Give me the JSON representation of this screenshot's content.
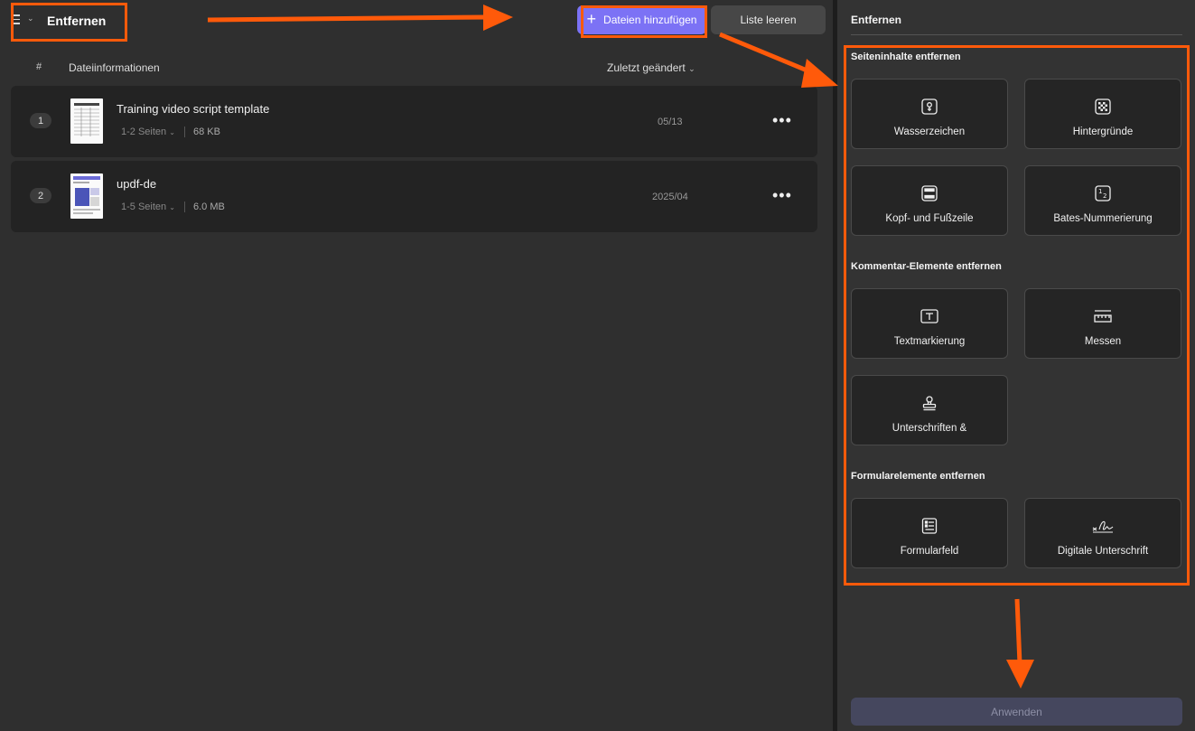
{
  "header": {
    "title": "Entfernen",
    "add_files_label": "Dateien hinzufügen",
    "clear_list_label": "Liste leeren"
  },
  "table": {
    "col_number": "#",
    "col_info": "Dateiinformationen",
    "col_modified": "Zuletzt geändert",
    "rows": [
      {
        "index": "1",
        "name": "Training video script template",
        "pages": "1-2 Seiten",
        "size": "68 KB",
        "date": "05/13"
      },
      {
        "index": "2",
        "name": "updf-de",
        "pages": "1-5 Seiten",
        "size": "6.0 MB",
        "date": "2025/04"
      }
    ]
  },
  "panel": {
    "title": "Entfernen",
    "section_page": "Seiteninhalte entfernen",
    "section_comment": "Kommentar-Elemente entfernen",
    "section_form": "Formularelemente entfernen",
    "items": {
      "watermark": "Wasserzeichen",
      "backgrounds": "Hintergründe",
      "header_footer": "Kopf- und Fußzeile",
      "bates": "Bates-Nummerierung",
      "markup": "Textmarkierung",
      "measure": "Messen",
      "signatures": "Unterschriften &",
      "form_field": "Formularfeld",
      "digital_signature": "Digitale Unterschrift"
    },
    "apply_label": "Anwenden"
  },
  "colors": {
    "accent": "#7c72f5",
    "annotation": "#ff5a0a",
    "background": "#2f2f2f"
  }
}
